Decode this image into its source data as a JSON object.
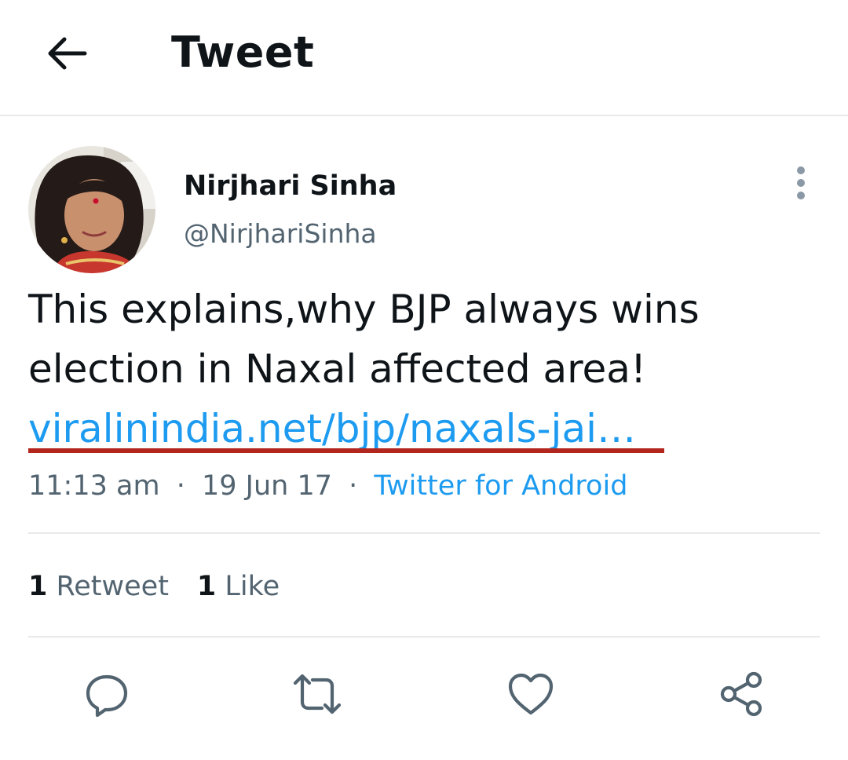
{
  "header": {
    "title": "Tweet",
    "back_icon": "arrow-left-icon"
  },
  "author": {
    "display_name": "Nirjhari Sinha",
    "handle": "@NirjhariSinha"
  },
  "tweet": {
    "text": "This explains,why BJP always wins election in Naxal affected area!",
    "link": "viralinindia.net/bjp/naxals-jai…",
    "time": "11:13 am",
    "date": "19 Jun 17",
    "source": "Twitter for Android",
    "separator": "·"
  },
  "stats": {
    "retweets_count": "1",
    "retweets_label": "Retweet",
    "likes_count": "1",
    "likes_label": "Like"
  },
  "actions": [
    "reply-icon",
    "retweet-icon",
    "like-icon",
    "share-icon"
  ],
  "colors": {
    "link": "#1d9bf0",
    "text": "#0f1419",
    "muted": "#536471",
    "divider": "#e7e9ea",
    "annotation_underline": "#b3261e"
  }
}
